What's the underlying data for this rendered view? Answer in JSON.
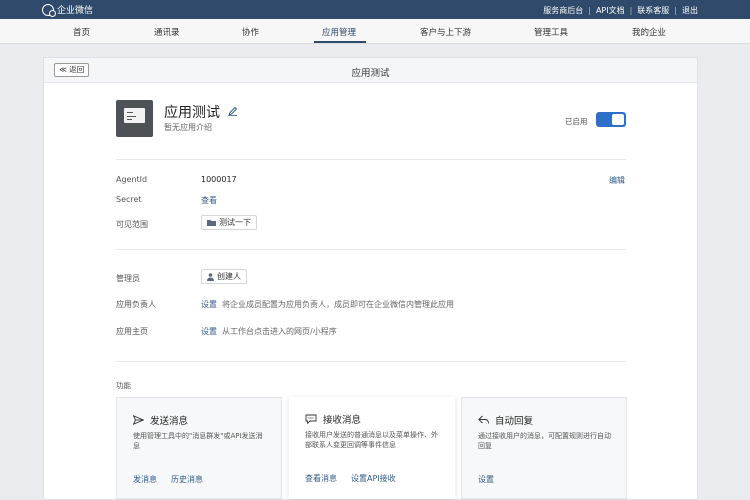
{
  "topbar": {
    "brand": "企业微信",
    "links": [
      "服务商后台",
      "API文档",
      "联系客服",
      "退出"
    ]
  },
  "nav": {
    "items": [
      "首页",
      "通讯录",
      "协作",
      "应用管理",
      "客户与上下游",
      "管理工具",
      "我的企业"
    ],
    "active": "应用管理"
  },
  "panel": {
    "back_label": "≪ 返回",
    "title": "应用测试"
  },
  "app": {
    "name": "应用测试",
    "description": "暂无应用介绍",
    "status": "已启用",
    "enabled": true
  },
  "details": {
    "agentid_label": "AgentId",
    "agentid_value": "1000017",
    "edit_label": "编辑",
    "secret_label": "Secret",
    "secret_action": "查看",
    "visible_label": "可见范围",
    "visible_value": "测试一下"
  },
  "admin": {
    "admin_label": "管理员",
    "admin_value": "创建人",
    "owner_label": "应用负责人",
    "owner_action": "设置",
    "owner_hint": "将企业成员配置为应用负责人，成员即可在企业微信内管理此应用",
    "home_label": "应用主页",
    "home_action": "设置",
    "home_hint": "从工作台点击进入的网页/小程序"
  },
  "features": {
    "section_label": "功能",
    "cards": [
      {
        "title": "发送消息",
        "desc": "使用管理工具中的\"消息群发\"或API发送消息",
        "links": [
          "发消息",
          "历史消息"
        ]
      },
      {
        "title": "接收消息",
        "desc": "接收用户发送的普通消息以及菜单操作、外部联系人变更回调等事件信息",
        "links": [
          "查看消息",
          "设置API接收"
        ]
      },
      {
        "title": "自动回复",
        "desc": "通过接收用户的消息，可配置规则进行自动回复",
        "links": [
          "设置"
        ]
      }
    ]
  },
  "colors": {
    "topbar": "#2f4a6a",
    "link": "#2f5a88",
    "toggle": "#2e6fc8"
  }
}
